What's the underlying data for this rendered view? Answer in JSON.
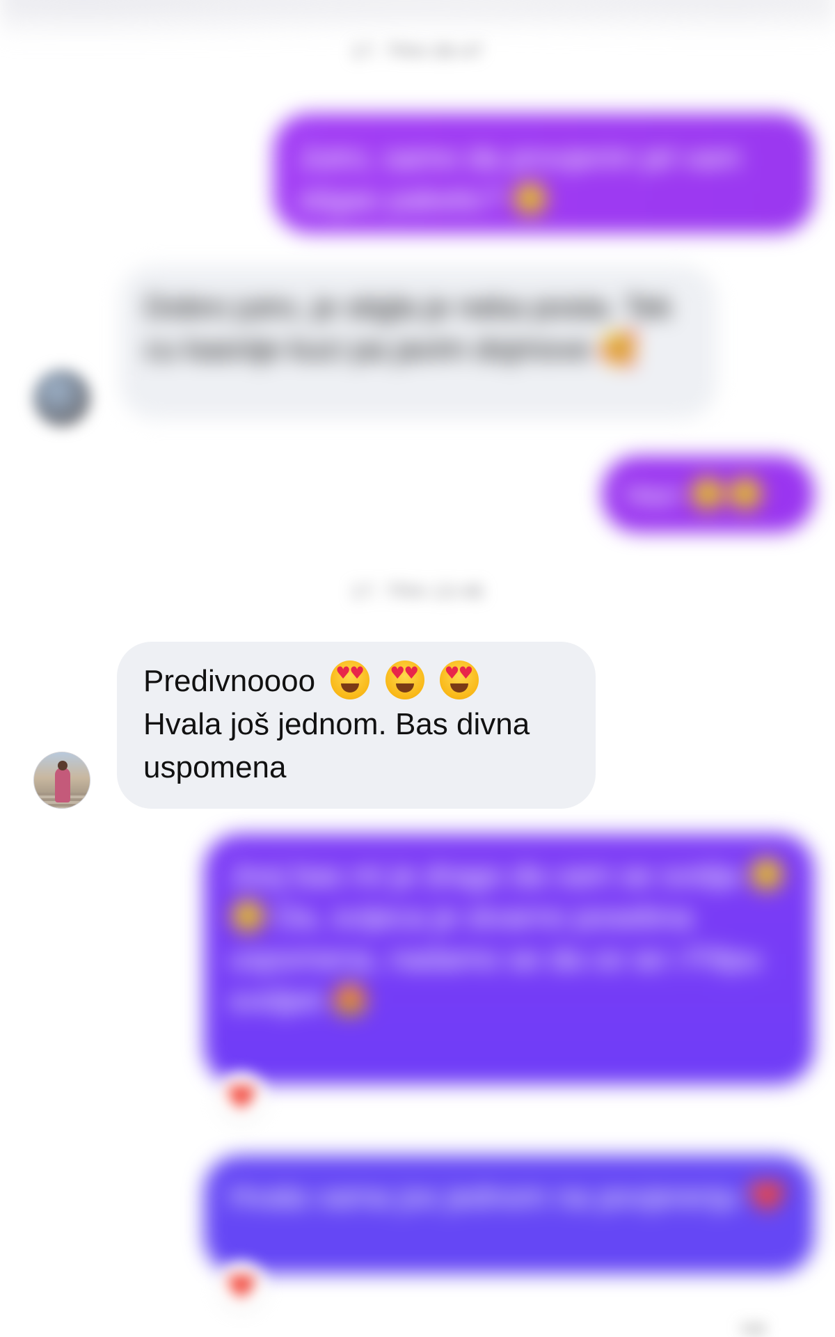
{
  "conversation": {
    "timestamp_1": "17. TRA 09:47",
    "timestamp_2": "17. TRA 13:46",
    "messages": [
      {
        "direction": "outgoing",
        "text": "Jutro, samo da provjerim jel vam stigao paketic? 😊",
        "blurred": true
      },
      {
        "direction": "incoming",
        "text": "Dobro jutro, je stigla je neka posta. Tek cu kasnije kuci pa javim dojmove 🥰",
        "blurred": true
      },
      {
        "direction": "outgoing",
        "text": "Vazi 😊😊",
        "blurred": true
      },
      {
        "direction": "incoming",
        "line_1": "Predivnoooo",
        "line_2": "Hvala još jednom. Bas divna",
        "line_3": "uspomena",
        "emoji_count": 3,
        "emoji": "heart-eyes-emoji",
        "blurred": false
      },
      {
        "direction": "outgoing",
        "text": "Jooj bas mi je drago da vam se svidja 😊😊 Da, svijeca je stvarno posebna uspomena, nadamo se da ce se i Filipu svidjeti 😍",
        "reaction": "❤️",
        "blurred": true
      },
      {
        "direction": "outgoing",
        "text": "Hvala vama jos jednom na povjerenju ❤️",
        "reaction": "❤️",
        "blurred": true
      }
    ],
    "status": "Vidi"
  },
  "colors": {
    "outgoing_top": "#a23df5",
    "outgoing_mid": "#7e3cf6",
    "outgoing_bottom": "#6547f5",
    "incoming": "#eef0f4",
    "reaction_heart": "#e0334a"
  }
}
